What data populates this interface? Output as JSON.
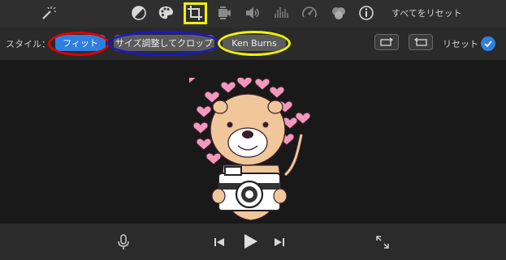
{
  "toolbar": {
    "icons": [
      "magic-wand-icon",
      "color-balance-icon",
      "palette-icon",
      "crop-icon",
      "stabilization-icon",
      "volume-icon",
      "equalizer-icon",
      "speed-icon",
      "filter-icon",
      "info-icon"
    ],
    "reset_all_label": "すべてをリセット",
    "active_icon": "crop-icon",
    "highlight_color": "#f2f200"
  },
  "style_bar": {
    "label": "スタイル：",
    "options": [
      "フィット",
      "サイズ調整してクロップ",
      "Ken Burns"
    ],
    "selected": "フィット",
    "reset_label": "リセット",
    "accent": "#2f7fe0",
    "annotation_colors": [
      "#e00000",
      "#1a18c8",
      "#f2f200"
    ]
  },
  "controls": {
    "icons": [
      "microphone-icon",
      "skip-back-icon",
      "play-icon",
      "skip-forward-icon",
      "fullscreen-icon"
    ]
  }
}
